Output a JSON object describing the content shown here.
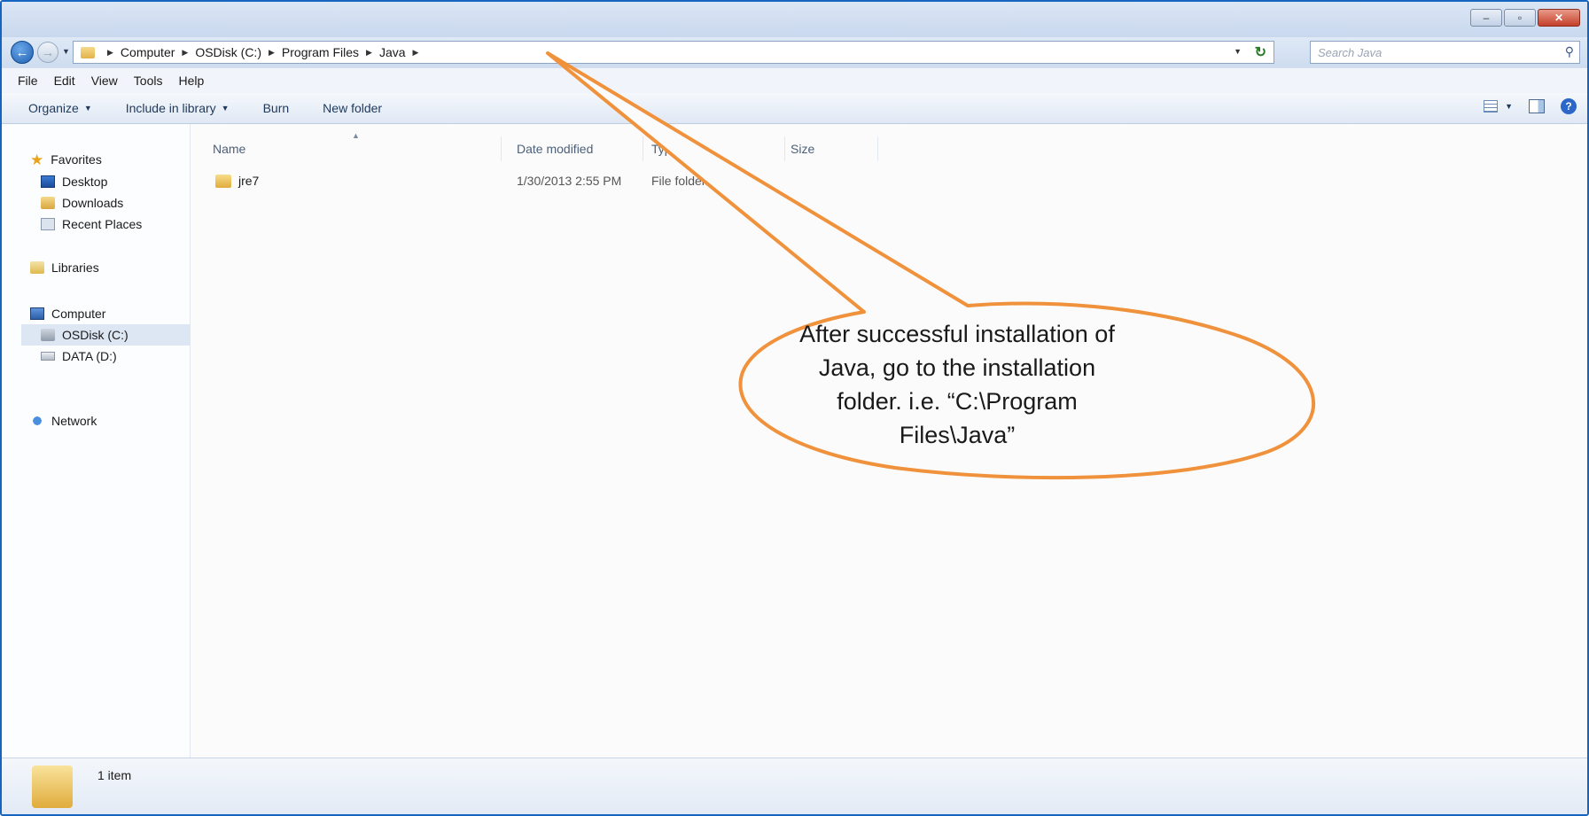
{
  "window": {
    "controls": {
      "minimize": "–",
      "maximize": "▫",
      "close": "✕"
    }
  },
  "navigation": {
    "back_icon": "back-arrow-icon",
    "forward_icon": "forward-arrow-icon",
    "breadcrumb": [
      "Computer",
      "OSDisk (C:)",
      "Program Files",
      "Java"
    ],
    "search_placeholder": "Search Java"
  },
  "menu": [
    "File",
    "Edit",
    "View",
    "Tools",
    "Help"
  ],
  "toolbar": {
    "organize": "Organize",
    "include_in_library": "Include in library",
    "burn": "Burn",
    "new_folder": "New folder"
  },
  "sidebar": {
    "favorites": {
      "label": "Favorites",
      "items": [
        "Desktop",
        "Downloads",
        "Recent Places"
      ]
    },
    "libraries": {
      "label": "Libraries"
    },
    "computer": {
      "label": "Computer",
      "items": [
        "OSDisk (C:)",
        "DATA (D:)"
      ],
      "selected": "OSDisk (C:)"
    },
    "network": {
      "label": "Network"
    }
  },
  "file_list": {
    "columns": [
      "Name",
      "Date modified",
      "Type",
      "Size"
    ],
    "rows": [
      {
        "name": "jre7",
        "date_modified": "1/30/2013 2:55 PM",
        "type": "File folder",
        "size": ""
      }
    ]
  },
  "status": {
    "item_count": "1 item"
  },
  "annotation": {
    "text": "After successful installation of\nJava, go to the installation\nfolder. i.e. “C:\\Program\nFiles\\Java”",
    "color": "#f0913c"
  }
}
